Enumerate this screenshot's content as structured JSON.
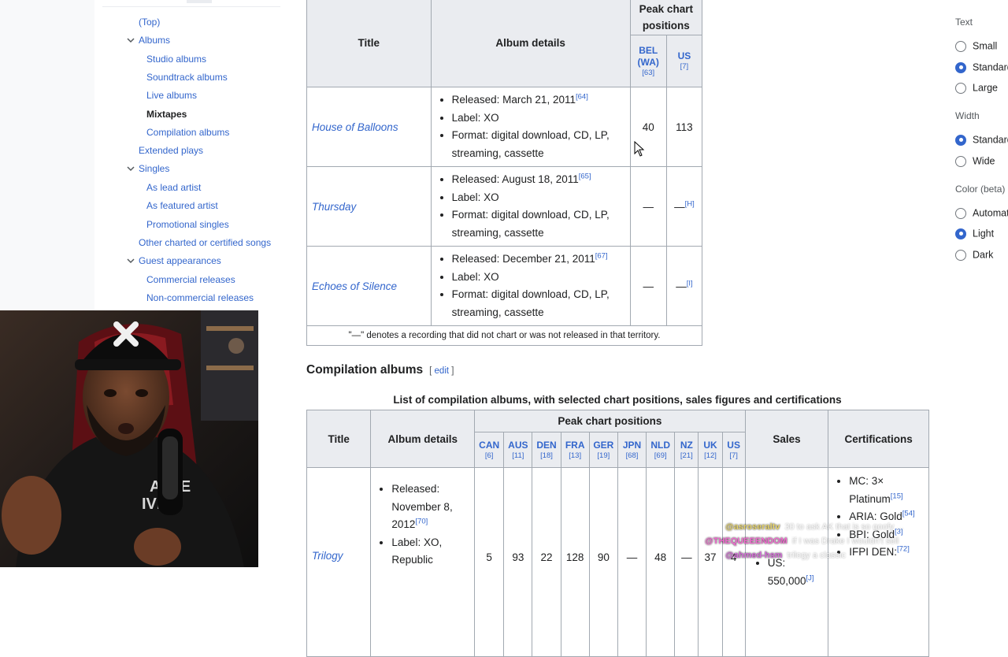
{
  "toc": {
    "items": [
      {
        "label": "(Top)",
        "level": 1
      },
      {
        "label": "Albums",
        "level": 1,
        "expanded": true
      },
      {
        "label": "Studio albums",
        "level": 2
      },
      {
        "label": "Soundtrack albums",
        "level": 2
      },
      {
        "label": "Live albums",
        "level": 2
      },
      {
        "label": "Mixtapes",
        "level": 2,
        "active": true
      },
      {
        "label": "Compilation albums",
        "level": 2
      },
      {
        "label": "Extended plays",
        "level": 1
      },
      {
        "label": "Singles",
        "level": 1,
        "expanded": true
      },
      {
        "label": "As lead artist",
        "level": 2
      },
      {
        "label": "As featured artist",
        "level": 2
      },
      {
        "label": "Promotional singles",
        "level": 2
      },
      {
        "label": "Other charted or certified songs",
        "level": 1
      },
      {
        "label": "Guest appearances",
        "level": 1,
        "expanded": true
      },
      {
        "label": "Commercial releases",
        "level": 2
      },
      {
        "label": "Non-commercial releases",
        "level": 2
      }
    ]
  },
  "appearance": {
    "text_heading": "Text",
    "text_options": [
      {
        "label": "Small",
        "selected": false
      },
      {
        "label": "Standard",
        "selected": true
      },
      {
        "label": "Large",
        "selected": false
      }
    ],
    "width_heading": "Width",
    "width_options": [
      {
        "label": "Standard",
        "selected": true
      },
      {
        "label": "Wide",
        "selected": false
      }
    ],
    "color_heading": "Color (beta)",
    "color_options": [
      {
        "label": "Automatic",
        "selected": false
      },
      {
        "label": "Light",
        "selected": true
      },
      {
        "label": "Dark",
        "selected": false
      }
    ]
  },
  "mixtapes_table": {
    "headers": {
      "title": "Title",
      "album_details": "Album details",
      "peak": "Peak chart positions",
      "charts": [
        {
          "label": "BEL (WA)",
          "ref": "[63]"
        },
        {
          "label": "US",
          "ref": "[7]"
        }
      ]
    },
    "rows": [
      {
        "title": "House of Balloons",
        "released": "Released: March 21, 2011",
        "released_ref": "[64]",
        "label": "Label: XO",
        "format_1": "Format: digital download, CD, LP,",
        "format_2": "streaming, cassette",
        "bel": "40",
        "us": "113",
        "us_note": ""
      },
      {
        "title": "Thursday",
        "released": "Released: August 18, 2011",
        "released_ref": "[65]",
        "label": "Label: XO",
        "format_1": "Format: digital download, CD, LP,",
        "format_2": "streaming, cassette",
        "bel": "—",
        "us": "—",
        "us_note": "[H]"
      },
      {
        "title": "Echoes of Silence",
        "released": "Released: December 21, 2011",
        "released_ref": "[67]",
        "label": "Label: XO",
        "format_1": "Format: digital download, CD, LP,",
        "format_2": "streaming, cassette",
        "bel": "—",
        "us": "—",
        "us_note": "[I]"
      }
    ],
    "note": "\"—\" denotes a recording that did not chart or was not released in that territory."
  },
  "compilation_section": {
    "heading": "Compilation albums",
    "edit_open": "[",
    "edit_label": "edit",
    "edit_close": "]",
    "caption": "List of compilation albums, with selected chart positions, sales figures and certifications"
  },
  "compilation_table": {
    "headers": {
      "title": "Title",
      "album_details": "Album details",
      "peak": "Peak chart positions",
      "sales": "Sales",
      "certifications": "Certifications",
      "charts": [
        {
          "label": "CAN",
          "ref": "[6]"
        },
        {
          "label": "AUS",
          "ref": "[11]"
        },
        {
          "label": "DEN",
          "ref": "[18]"
        },
        {
          "label": "FRA",
          "ref": "[13]"
        },
        {
          "label": "GER",
          "ref": "[19]"
        },
        {
          "label": "JPN",
          "ref": "[68]"
        },
        {
          "label": "NLD",
          "ref": "[69]"
        },
        {
          "label": "NZ",
          "ref": "[21]"
        },
        {
          "label": "UK",
          "ref": "[12]"
        },
        {
          "label": "US",
          "ref": "[7]"
        }
      ]
    },
    "row": {
      "title": "Trilogy",
      "released_1": "Released:",
      "released_2": "November 8,",
      "released_3": "2012",
      "released_ref": "[70]",
      "label_1": "Label: XO,",
      "label_2": "Republic",
      "positions": [
        "5",
        "93",
        "22",
        "128",
        "90",
        "—",
        "48",
        "—",
        "37",
        "4"
      ],
      "sales_partial": "US: 550,000",
      "sales_ref": "[J]",
      "cert_1_a": "MC: 3×",
      "cert_1_b": "Platinum",
      "cert_1_ref": "[15]",
      "cert_2": "ARIA: Gold",
      "cert_2_ref": "[54]",
      "cert_3": "BPI: Gold",
      "cert_3_ref": "[3]",
      "cert_4": "IFPI DEN:",
      "cert_4_ref": "[72]"
    }
  },
  "chat": [
    {
      "user": "@asroseraltv",
      "message": "30 to ask AK that is so goofy ...",
      "color": "#e6d36a"
    },
    {
      "user": "@THEQUEEENDOM",
      "message": "if I was Drake I wouldn't sell",
      "color": "#f26ad0"
    },
    {
      "user": "@ahmed-hsm",
      "message": "trilogy a classic",
      "color": "#d46ad8"
    }
  ]
}
